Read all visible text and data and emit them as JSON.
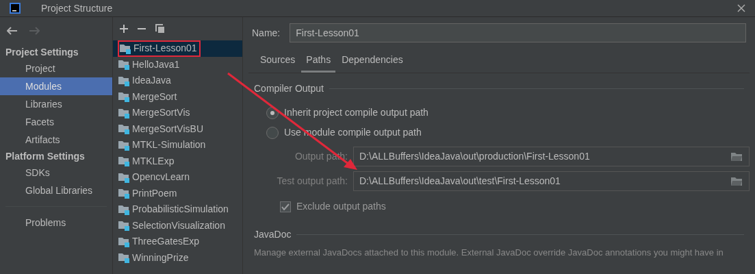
{
  "window": {
    "title": "Project Structure"
  },
  "nav": {
    "back_disabled": false,
    "forward_disabled": true
  },
  "sidebar": {
    "sections": [
      {
        "title": "Project Settings",
        "items": [
          {
            "label": "Project",
            "selected": false
          },
          {
            "label": "Modules",
            "selected": true
          },
          {
            "label": "Libraries",
            "selected": false
          },
          {
            "label": "Facets",
            "selected": false
          },
          {
            "label": "Artifacts",
            "selected": false
          }
        ]
      },
      {
        "title": "Platform Settings",
        "items": [
          {
            "label": "SDKs",
            "selected": false
          },
          {
            "label": "Global Libraries",
            "selected": false
          }
        ]
      }
    ],
    "footer_items": [
      {
        "label": "Problems",
        "selected": false
      }
    ]
  },
  "modules": {
    "items": [
      {
        "label": "First-Lesson01",
        "selected": true
      },
      {
        "label": "HelloJava1",
        "selected": false
      },
      {
        "label": "IdeaJava",
        "selected": false
      },
      {
        "label": "MergeSort",
        "selected": false
      },
      {
        "label": "MergeSortVis",
        "selected": false
      },
      {
        "label": "MergeSortVisBU",
        "selected": false
      },
      {
        "label": "MTKL-Simulation",
        "selected": false
      },
      {
        "label": "MTKLExp",
        "selected": false
      },
      {
        "label": "OpencvLearn",
        "selected": false
      },
      {
        "label": "PrintPoem",
        "selected": false
      },
      {
        "label": "ProbabilisticSimulation",
        "selected": false
      },
      {
        "label": "SelectionVisualization",
        "selected": false
      },
      {
        "label": "ThreeGatesExp",
        "selected": false
      },
      {
        "label": "WinningPrize",
        "selected": false
      }
    ]
  },
  "details": {
    "name_label": "Name:",
    "name_value": "First-Lesson01",
    "tabs": [
      {
        "label": "Sources",
        "selected": false
      },
      {
        "label": "Paths",
        "selected": true
      },
      {
        "label": "Dependencies",
        "selected": false
      }
    ],
    "compiler_output": {
      "title": "Compiler Output",
      "options": [
        {
          "label": "Inherit project compile output path",
          "selected": true
        },
        {
          "label": "Use module compile output path",
          "selected": false
        }
      ],
      "paths": [
        {
          "label": "Output path:",
          "value": "D:\\ALLBuffers\\IdeaJava\\out\\production\\First-Lesson01",
          "disabled": true
        },
        {
          "label": "Test output path:",
          "value": "D:\\ALLBuffers\\IdeaJava\\out\\test\\First-Lesson01",
          "disabled": true
        }
      ],
      "exclude": {
        "label": "Exclude output paths",
        "checked": true,
        "disabled": true
      }
    },
    "javadoc": {
      "title": "JavaDoc",
      "description": "Manage external JavaDocs attached to this module. External JavaDoc override JavaDoc annotations you might have in"
    }
  }
}
